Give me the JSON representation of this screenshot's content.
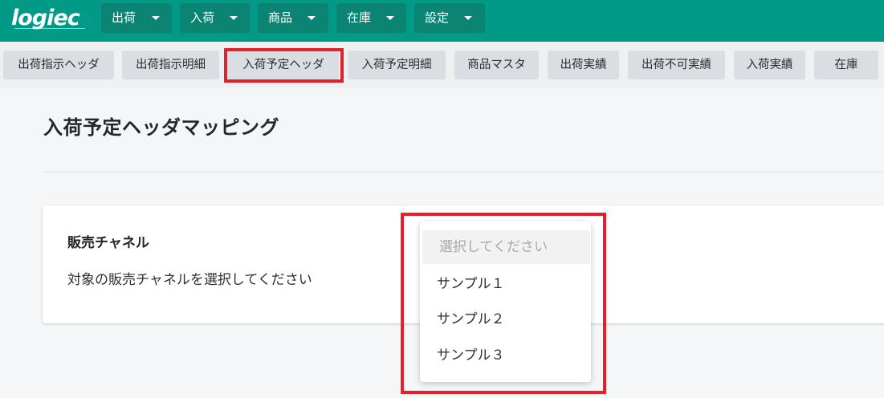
{
  "app": {
    "logo": "logiec"
  },
  "topnav": {
    "items": [
      {
        "label": "出荷"
      },
      {
        "label": "入荷"
      },
      {
        "label": "商品"
      },
      {
        "label": "在庫"
      },
      {
        "label": "設定"
      }
    ]
  },
  "subnav": {
    "active": "入荷予定ヘッダ",
    "items": [
      {
        "label": "出荷指示ヘッダ"
      },
      {
        "label": "出荷指示明細"
      },
      {
        "label": "入荷予定ヘッダ"
      },
      {
        "label": "入荷予定明細"
      },
      {
        "label": "商品マスタ"
      },
      {
        "label": "出荷実績"
      },
      {
        "label": "出荷不可実績"
      },
      {
        "label": "入荷実績"
      },
      {
        "label": "在庫"
      }
    ]
  },
  "main": {
    "page_title": "入荷予定ヘッダマッピング",
    "card": {
      "title": "販売チャネル",
      "description": "対象の販売チャネルを選択してください"
    },
    "dropdown": {
      "placeholder": "選択してください",
      "options": [
        "サンプル１",
        "サンプル２",
        "サンプル３"
      ]
    }
  },
  "colors": {
    "header_bg": "#009a87",
    "menu_button_bg": "#0b8474",
    "highlight": "#e1222a"
  }
}
